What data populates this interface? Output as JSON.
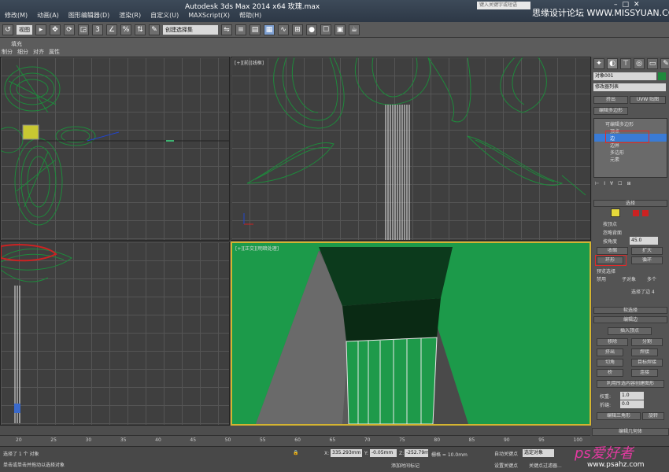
{
  "window": {
    "title": "Autodesk 3ds Max  2014 x64     玫瑰.max",
    "search_placeholder": "键入关键字或短语",
    "watermark_top": "思缘设计论坛 WWW.MISSYUAN.COM",
    "watermark_bottom": "ps爱好者",
    "watermark_bottom_url": "www.psahz.com"
  },
  "menu": [
    "修改(M)",
    "动画(A)",
    "图形编辑器(D)",
    "渲染(R)",
    "自定义(U)",
    "MAXScript(X)",
    "帮助(H)"
  ],
  "toolbar": {
    "view_dropdown": "视图",
    "selection_set_dropdown": "创建选择集"
  },
  "ribbon": {
    "label": "填充",
    "tabs": [
      "制分",
      "细分",
      "对齐",
      "属性"
    ]
  },
  "viewports": {
    "top_right_label": "[+][前][线框]",
    "bottom_right_label": "[+][正交][明暗处理]"
  },
  "command_panel": {
    "object_name": "对象001",
    "modifier_list": "修改器列表",
    "buttons": [
      "挤出",
      "UVW 贴图",
      "编辑多边形"
    ],
    "stack": [
      "可编辑多边形",
      "顶点",
      "边",
      "边界",
      "多边形",
      "元素"
    ],
    "selection_header": "选择",
    "by_vertex": "按顶点",
    "ignore_backface": "忽略背面",
    "by_angle": "按角度",
    "angle_value": "45.0",
    "shrink": "收缩",
    "grow": "扩大",
    "ring": "环形",
    "loop": "循环",
    "preview_selection": "预览选择",
    "preview_options": [
      "禁用",
      "子对象",
      "多个"
    ],
    "selected_count": "选择了边 4",
    "soft_selection": "软选择",
    "edit_edges": "编辑边",
    "insert_vertex": "插入顶点",
    "remove": "移除",
    "split": "分割",
    "extrude": "挤出",
    "weld": "焊接",
    "chamfer": "切角",
    "target_weld": "目标焊接",
    "bridge": "桥",
    "connect": "连接",
    "create_shape": "利用所选内容创建图形",
    "weight_label": "权重:",
    "weight_value": "1.0",
    "crease_label": "折缝:",
    "crease_value": "0.0",
    "edit_tri": "编辑三角形",
    "turn": "旋转",
    "edit_geometry": "编辑几何体"
  },
  "timeline": {
    "ticks": [
      "20",
      "25",
      "30",
      "35",
      "40",
      "45",
      "50",
      "55",
      "60",
      "65",
      "70",
      "75",
      "80",
      "85",
      "90",
      "95",
      "100"
    ]
  },
  "status": {
    "line1": "选择了 1 个 对象",
    "line2": "单击或单击并拖动以选择对象",
    "x_label": "X:",
    "x_value": "335.293mm",
    "y_label": "Y:",
    "y_value": "-0.05mm",
    "z_label": "Z:",
    "z_value": "-252.79mm",
    "grid": "栅格 = 10.0mm",
    "auto_key": "自动关键点",
    "selected_object": "选定对象",
    "set_key": "设置关键点",
    "key_filter": "关键点过滤器...",
    "add_time_tag": "添加时间标记"
  },
  "colors": {
    "wire_green": "#1e8a3c",
    "shaded_green": "#1c9a4a",
    "highlight_blue": "#3a7bd5",
    "annotation_red": "#e02a2a"
  }
}
